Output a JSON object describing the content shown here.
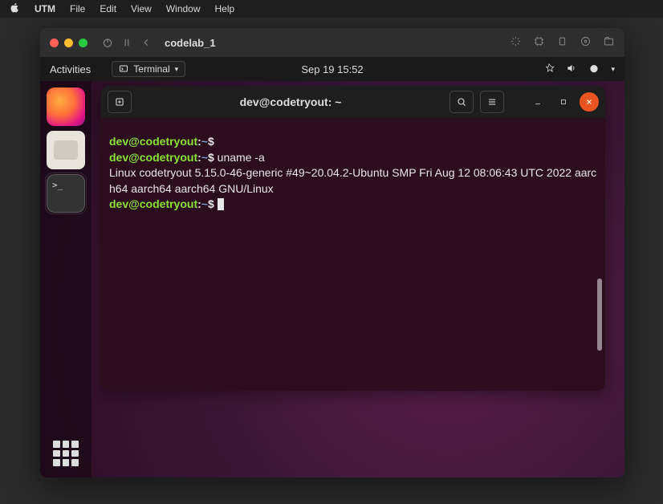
{
  "mac_menu": {
    "app": "UTM",
    "items": [
      "File",
      "Edit",
      "View",
      "Window",
      "Help"
    ]
  },
  "utm": {
    "title": "codelab_1"
  },
  "gnome": {
    "activities": "Activities",
    "app_indicator": "Terminal",
    "datetime": "Sep 19  15:52"
  },
  "terminal": {
    "title": "dev@codetryout: ~",
    "prompt_user": "dev@codetryout",
    "prompt_path": "~",
    "prompt_sym": "$",
    "lines": [
      {
        "type": "prompt",
        "cmd": ""
      },
      {
        "type": "prompt",
        "cmd": "uname -a"
      },
      {
        "type": "output",
        "text": "Linux codetryout 5.15.0-46-generic #49~20.04.2-Ubuntu SMP Fri Aug 12 08:06:43 UTC 2022 aarch64 aarch64 aarch64 GNU/Linux"
      },
      {
        "type": "prompt",
        "cmd": "",
        "cursor": true
      }
    ]
  }
}
